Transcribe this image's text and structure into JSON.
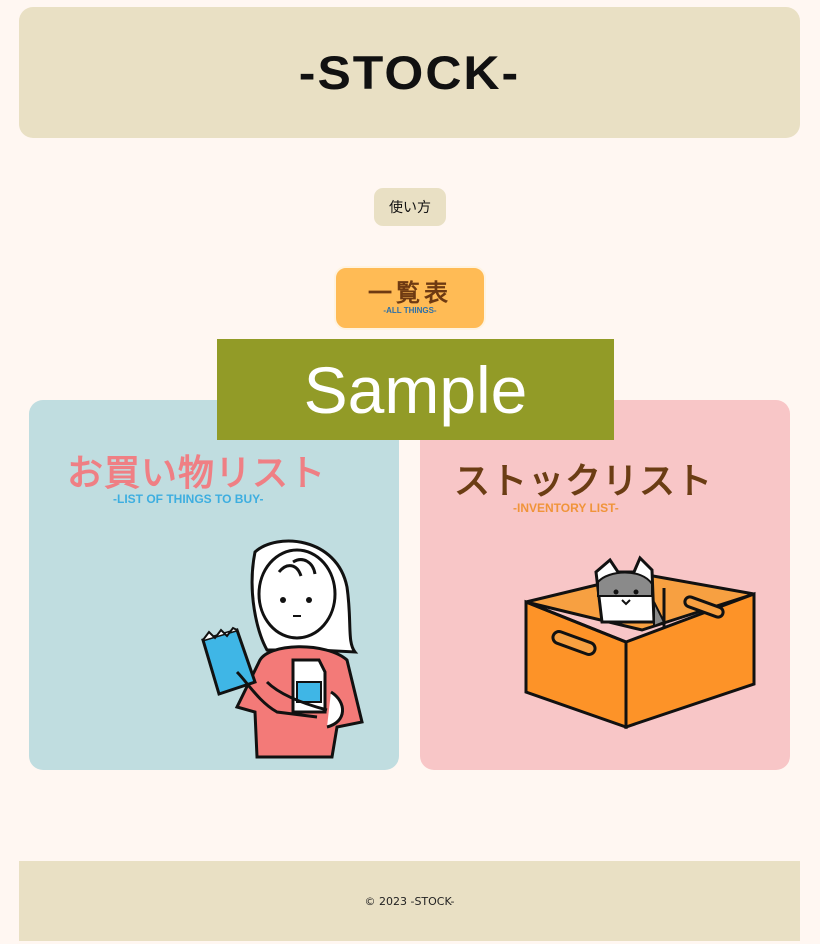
{
  "header": {
    "logo_text": "-STOCK-"
  },
  "nav": {
    "howto_label": "使い方",
    "all_things": {
      "title": "一覧表",
      "subtitle": "-ALL THINGS-"
    }
  },
  "overlay": {
    "watermark": "Sample"
  },
  "cards": {
    "shopping": {
      "title": "お買い物リスト",
      "subtitle": "-LIST OF THINGS TO BUY-",
      "illustration": "girl-with-groceries"
    },
    "stock": {
      "title": "ストックリスト",
      "subtitle": "-INVENTORY LIST-",
      "illustration": "cat-in-box"
    }
  },
  "footer": {
    "copyright": "© 2023 -STOCK-"
  },
  "colors": {
    "background": "#fff7f2",
    "header": "#e9e0c4",
    "all_things": "#ffbb55",
    "shopping_card": "#c0dde0",
    "stock_card": "#f8c6c7",
    "watermark": "#929b27"
  }
}
